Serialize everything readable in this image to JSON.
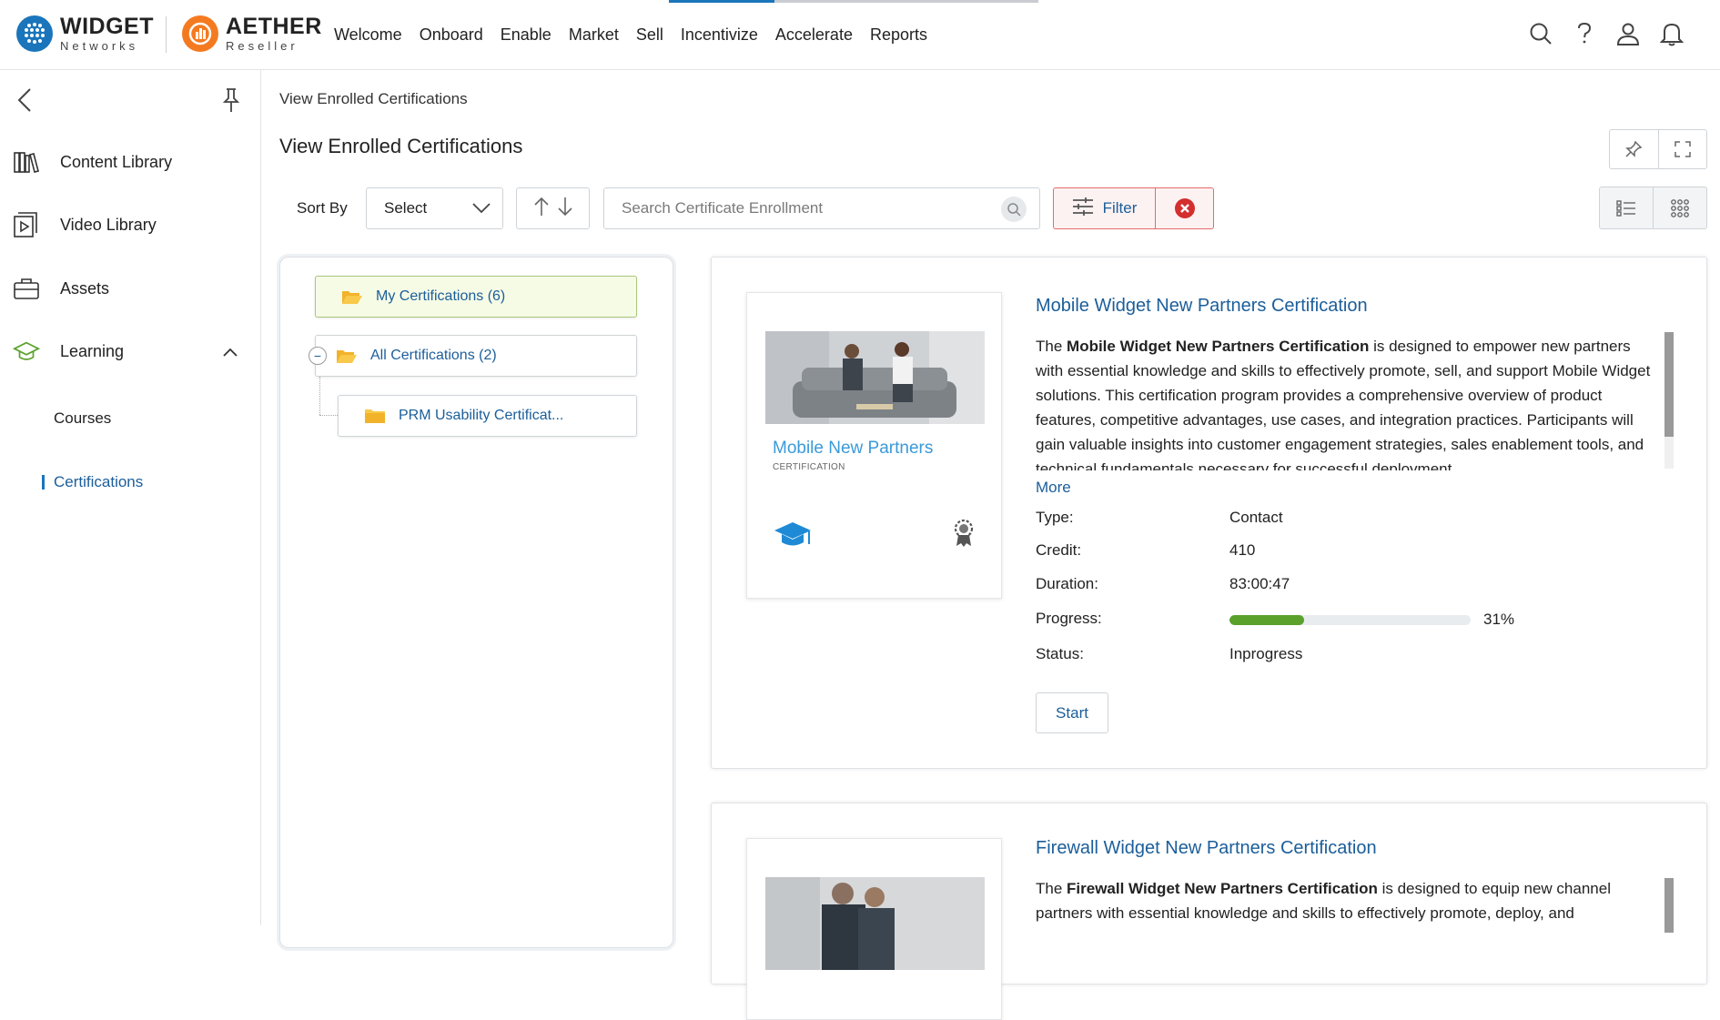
{
  "brand": {
    "widget": {
      "name": "WIDGET",
      "sub": "Networks"
    },
    "aether": {
      "name": "AETHER",
      "sub": "Reseller"
    }
  },
  "nav": [
    "Welcome",
    "Onboard",
    "Enable",
    "Market",
    "Sell",
    "Incentivize",
    "Accelerate",
    "Reports"
  ],
  "sidebar": {
    "items": [
      {
        "label": "Content Library",
        "icon": "books-icon"
      },
      {
        "label": "Video Library",
        "icon": "video-icon"
      },
      {
        "label": "Assets",
        "icon": "briefcase-icon"
      },
      {
        "label": "Learning",
        "icon": "graduation-cap-icon"
      }
    ],
    "sub_items": [
      "Courses",
      "Certifications"
    ],
    "active": "Certifications"
  },
  "breadcrumb": "View Enrolled Certifications",
  "page_title": "View Enrolled Certifications",
  "toolbar": {
    "sort_label": "Sort By",
    "sort_value": "Select",
    "search_placeholder": "Search Certificate Enrollment",
    "filter_label": "Filter"
  },
  "tree": {
    "my": "My Certifications (6)",
    "all": "All Certifications (2)",
    "child": "PRM Usability Certificat...",
    "toggle": "−"
  },
  "cards": [
    {
      "title": "Mobile Widget New Partners Certification",
      "thumb_title": "Mobile New Partners",
      "thumb_sub": "CERTIFICATION",
      "desc_prefix": "The ",
      "desc_bold": "Mobile Widget New Partners Certification",
      "desc_rest": " is designed to empower new partners with essential knowledge and skills to effectively promote, sell, and support Mobile Widget solutions. This certification program provides a comprehensive overview of product features, competitive advantages, use cases, and integration practices. Participants will gain valuable insights into customer engagement strategies, sales enablement tools, and technical fundamentals necessary for successful deployment.",
      "more": "More",
      "labels": {
        "type": "Type:",
        "credit": "Credit:",
        "duration": "Duration:",
        "progress": "Progress:",
        "status": "Status:"
      },
      "type": "Contact",
      "credit": "410",
      "duration": "83:00:47",
      "progress": 31,
      "progress_text": "31%",
      "status": "Inprogress",
      "action": "Start"
    },
    {
      "title": "Firewall Widget New Partners Certification",
      "desc_prefix": "The ",
      "desc_bold": "Firewall Widget New Partners Certification",
      "desc_rest": " is designed to equip new channel partners with essential knowledge and skills to effectively promote, deploy, and"
    }
  ],
  "colors": {
    "accent": "#1b5e9a",
    "progress": "#5aa12b",
    "filter_border": "#e46a6a",
    "clear": "#d32f2f"
  }
}
